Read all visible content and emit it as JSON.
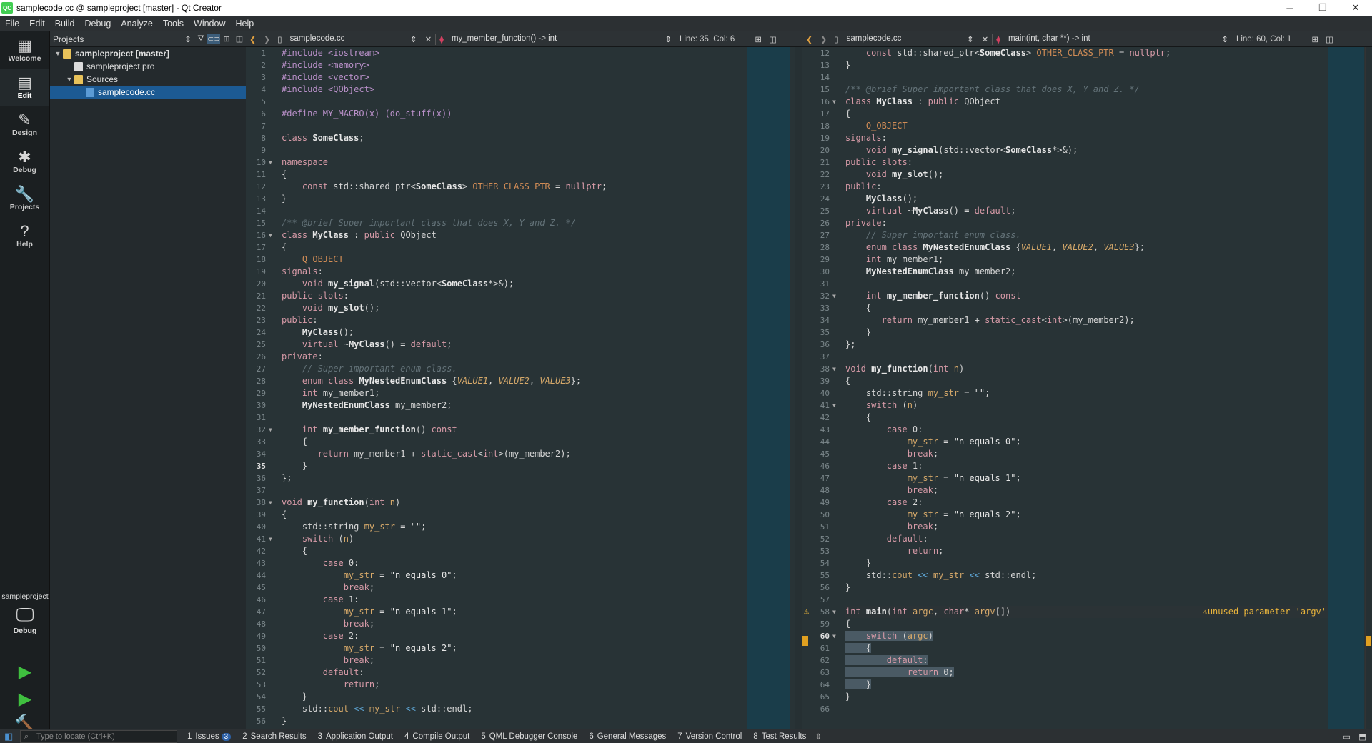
{
  "window": {
    "title": "samplecode.cc @ sampleproject [master] - Qt Creator",
    "minimize": "─",
    "maximize": "❐",
    "close": "✕"
  },
  "menu": [
    "File",
    "Edit",
    "Build",
    "Debug",
    "Analyze",
    "Tools",
    "Window",
    "Help"
  ],
  "modes": [
    {
      "label": "Welcome",
      "icon": "▦"
    },
    {
      "label": "Edit",
      "icon": "▤"
    },
    {
      "label": "Design",
      "icon": "✎"
    },
    {
      "label": "Debug",
      "icon": "✱"
    },
    {
      "label": "Projects",
      "icon": "🔧"
    },
    {
      "label": "Help",
      "icon": "?"
    }
  ],
  "kit": {
    "project": "sampleproject",
    "mode": "Debug"
  },
  "projects": {
    "selector": "Projects",
    "tree": [
      {
        "label": "sampleproject [master]",
        "level": 0,
        "arrow": "▼",
        "type": "project"
      },
      {
        "label": "sampleproject.pro",
        "level": 1,
        "arrow": "",
        "type": "file"
      },
      {
        "label": "Sources",
        "level": 1,
        "arrow": "▼",
        "type": "folder"
      },
      {
        "label": "samplecode.cc",
        "level": 2,
        "arrow": "",
        "type": "cc",
        "selected": true
      }
    ]
  },
  "left_editor": {
    "file": "samplecode.cc",
    "symbol": "my_member_function() -> int",
    "position": "Line: 35, Col: 6",
    "first_line": 1,
    "current_line": 35
  },
  "right_editor": {
    "file": "samplecode.cc",
    "symbol": "main(int, char **) -> int",
    "position": "Line: 60, Col: 1",
    "first_line": 12,
    "current_line": 60
  },
  "warning": "unused parameter 'argv'",
  "status": {
    "locator": "Type to locate (Ctrl+K)",
    "tabs": [
      {
        "n": "1",
        "label": "Issues",
        "badge": "3"
      },
      {
        "n": "2",
        "label": "Search Results"
      },
      {
        "n": "3",
        "label": "Application Output"
      },
      {
        "n": "4",
        "label": "Compile Output"
      },
      {
        "n": "5",
        "label": "QML Debugger Console"
      },
      {
        "n": "6",
        "label": "General Messages"
      },
      {
        "n": "7",
        "label": "Version Control"
      },
      {
        "n": "8",
        "label": "Test Results"
      }
    ]
  },
  "source": [
    "#include <iostream>",
    "#include <memory>",
    "#include <vector>",
    "#include <QObject>",
    "",
    "#define MY_MACRO(x) (do_stuff(x))",
    "",
    "class SomeClass;",
    "",
    "namespace",
    "{",
    "    const std::shared_ptr<SomeClass> OTHER_CLASS_PTR = nullptr;",
    "}",
    "",
    "/** @brief Super important class that does X, Y and Z. */",
    "class MyClass : public QObject",
    "{",
    "    Q_OBJECT",
    "signals:",
    "    void my_signal(std::vector<SomeClass*>&);",
    "public slots:",
    "    void my_slot();",
    "public:",
    "    MyClass();",
    "    virtual ~MyClass() = default;",
    "private:",
    "    // Super important enum class.",
    "    enum class MyNestedEnumClass {VALUE1, VALUE2, VALUE3};",
    "    int my_member1;",
    "    MyNestedEnumClass my_member2;",
    "",
    "    int my_member_function() const",
    "    {",
    "       return my_member1 + static_cast<int>(my_member2);",
    "    }",
    "};",
    "",
    "void my_function(int n)",
    "{",
    "    std::string my_str = \"\";",
    "    switch (n)",
    "    {",
    "        case 0:",
    "            my_str = \"n equals 0\";",
    "            break;",
    "        case 1:",
    "            my_str = \"n equals 1\";",
    "            break;",
    "        case 2:",
    "            my_str = \"n equals 2\";",
    "            break;",
    "        default:",
    "            return;",
    "    }",
    "    std::cout << my_str << std::endl;",
    "}",
    "",
    "int main(int argc, char* argv[])",
    "{",
    "    switch (argc)",
    "    {",
    "        default:",
    "            return 0;",
    "    }",
    "}",
    ""
  ]
}
